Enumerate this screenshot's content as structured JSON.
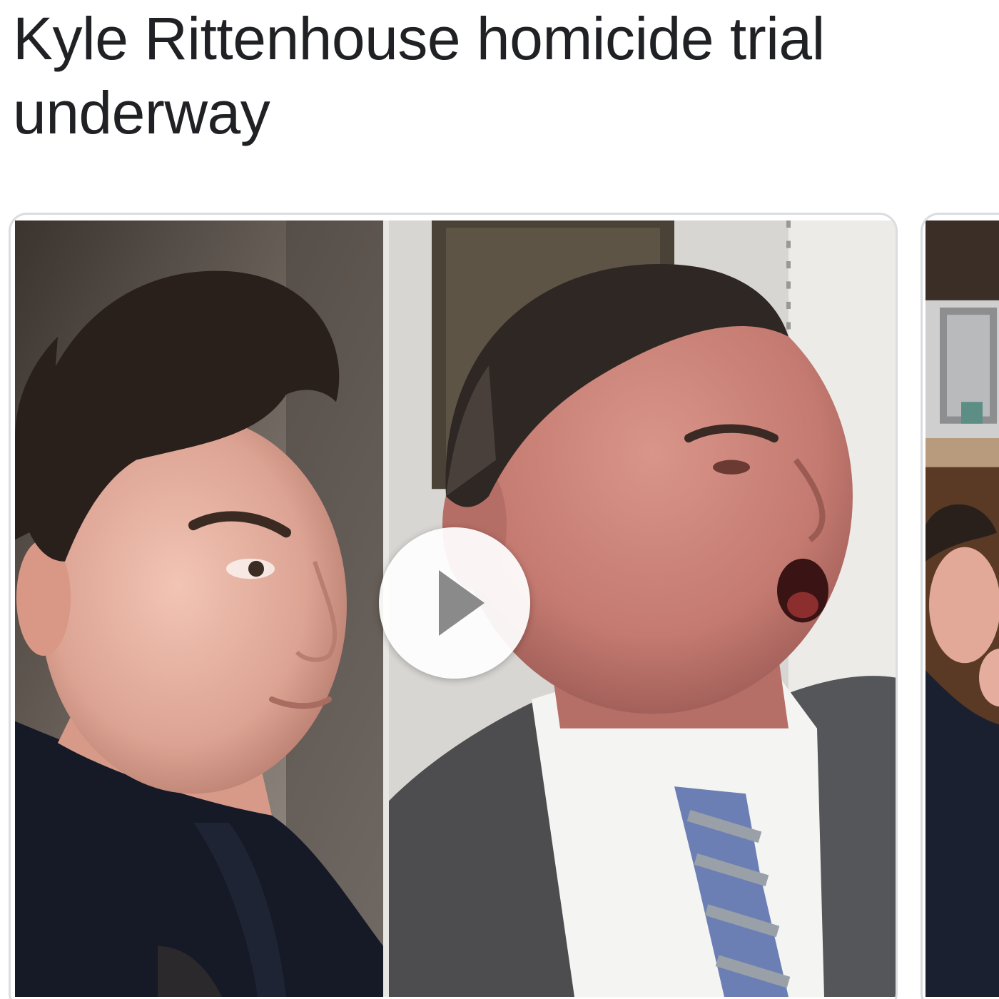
{
  "story": {
    "headline": "Kyle Rittenhouse homicide trial underway"
  },
  "media": {
    "primary_card": {
      "type": "video",
      "thumbnail_left": "young-man-in-courtroom",
      "thumbnail_right": "attorney-speaking",
      "play_icon": "play-icon"
    },
    "next_card": {
      "thumbnail": "courtroom-scene"
    }
  },
  "colors": {
    "headline": "#202124",
    "card_border": "#dadce0",
    "play_triangle": "#8a8a8a"
  }
}
